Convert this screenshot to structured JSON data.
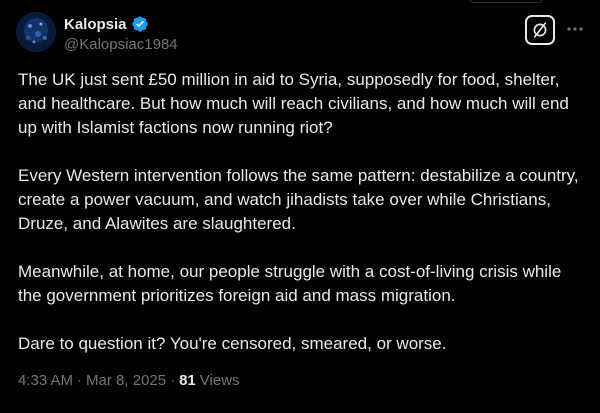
{
  "author": {
    "display_name": "Kalopsia",
    "handle": "@Kalopsiac1984",
    "verified": true,
    "avatar_icon": "avatar-image"
  },
  "actions": {
    "grok_icon": "grok-icon",
    "more_icon": "more-icon"
  },
  "tweet": {
    "paragraphs": [
      "The UK just sent £50 million in aid to Syria, supposedly for food, shelter, and healthcare. But how much will reach civilians, and how much will end up with Islamist factions now running riot?",
      "Every Western intervention follows the same pattern: destabilize a country, create a power vacuum, and watch jihadists take over while Christians, Druze, and Alawites are slaughtered.",
      "Meanwhile, at home, our people struggle with a cost-of-living crisis while the government prioritizes foreign aid and mass migration.",
      "Dare to question it? You're censored, smeared, or worse."
    ]
  },
  "meta": {
    "time": "4:33 AM",
    "separator": "·",
    "date": "Mar 8, 2025",
    "views_count": "81",
    "views_label": "Views"
  },
  "colors": {
    "background": "#000000",
    "text_primary": "#e7e9ea",
    "text_secondary": "#71767b",
    "verified_badge": "#1d9bf0"
  }
}
